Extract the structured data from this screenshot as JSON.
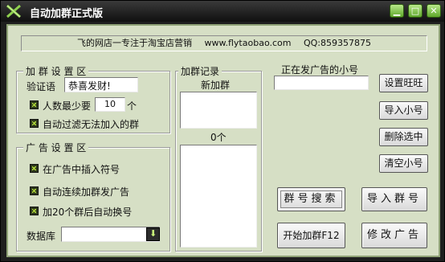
{
  "window": {
    "title": "自动加群正式版"
  },
  "banner": {
    "shop": "飞的网店一专注于淘宝店营销",
    "url": "www.flytaobao.com",
    "qq": "QQ:859357875"
  },
  "group_settings": {
    "legend": "加 群 设 置 区",
    "verify_label": "验证语",
    "verify_value": "恭喜发财!",
    "min_people_label": "人数最少要",
    "min_people_value": "10",
    "min_people_unit": "个",
    "auto_filter_label": "自动过滤无法加入的群"
  },
  "ad_settings": {
    "legend": "广 告 设 置 区",
    "insert_symbol_label": "在广告中插入符号",
    "continuous_label": "自动连续加群发广告",
    "switch_label": "加20个群后自动换号",
    "database_label": "数据库",
    "database_value": ""
  },
  "join_record": {
    "legend": "加群记录",
    "new_label": "新加群",
    "count_label": "0个"
  },
  "current_account": {
    "label": "正在发广告的小号",
    "value": ""
  },
  "buttons": {
    "login": "设置旺旺",
    "import_accounts": "导入小号",
    "delete_selected": "删除选中",
    "clear_accounts": "清空小号",
    "search_groups": "群号搜索",
    "import_groups": "导入群号",
    "start_join": "开始加群F12",
    "modify_ad": "修改广告"
  },
  "checkboxes": {
    "min_people": true,
    "auto_filter": true,
    "insert_symbol": true,
    "continuous": true,
    "switch_account": true
  }
}
